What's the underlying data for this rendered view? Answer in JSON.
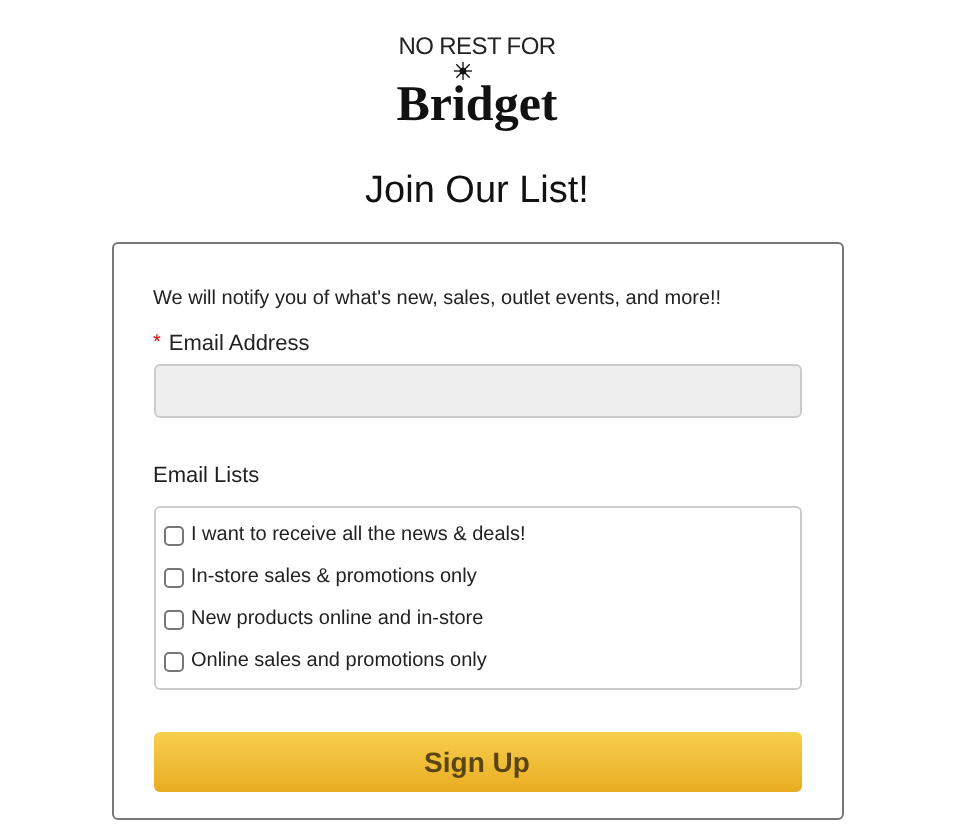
{
  "logo": {
    "top": "NO REST FOR",
    "bottom": "Bridget"
  },
  "title": "Join Our List!",
  "form": {
    "intro": "We will notify you of what's new, sales, outlet events, and more!!",
    "email": {
      "required_mark": "*",
      "label": "Email Address"
    },
    "lists_label": "Email Lists",
    "lists": [
      {
        "label": "I want to receive all the news & deals!",
        "checked": false
      },
      {
        "label": "In-store sales & promotions only",
        "checked": false
      },
      {
        "label": "New products online and in-store",
        "checked": false
      },
      {
        "label": "Online sales and promotions only",
        "checked": false
      }
    ],
    "submit": "Sign Up"
  }
}
